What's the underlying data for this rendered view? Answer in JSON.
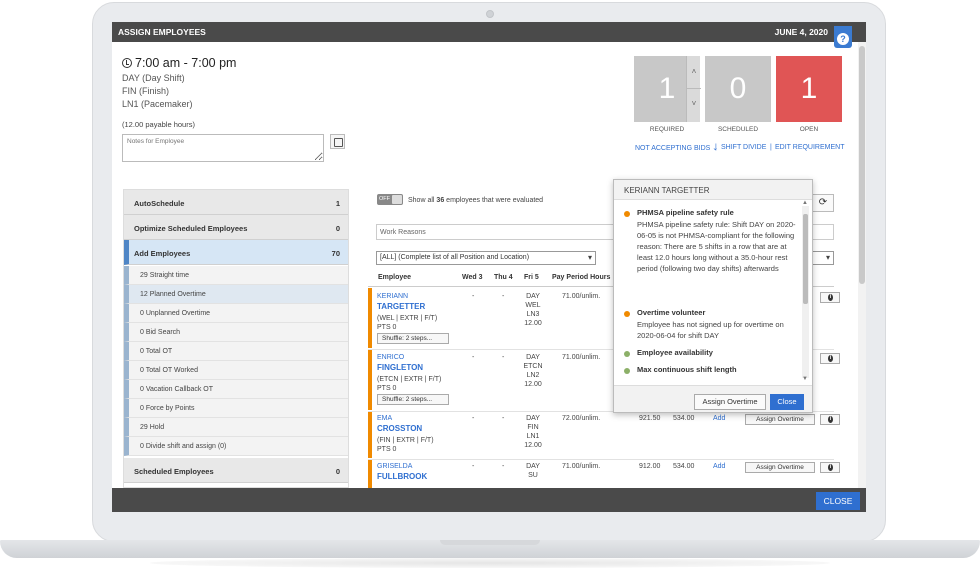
{
  "window": {
    "title": "ASSIGN EMPLOYEES",
    "date": "JUNE 4, 2020",
    "help_glyph": "?",
    "close_label": "CLOSE"
  },
  "shift": {
    "time": "7:00 am - 7:00 pm",
    "lines": [
      "DAY (Day Shift)",
      "FIN (Finish)",
      "LN1 (Pacemaker)"
    ],
    "payable": "(12.00 payable hours)",
    "notes_placeholder": "Notes for Employee"
  },
  "counters": [
    {
      "value": "1",
      "label": "REQUIRED",
      "color": "#c8c8c8"
    },
    {
      "value": "0",
      "label": "SCHEDULED",
      "color": "#c8c8c8"
    },
    {
      "value": "1",
      "label": "OPEN",
      "color": "#e05555"
    }
  ],
  "links": {
    "bids": "NOT ACCEPTING BIDS",
    "bids_caret": "⌄",
    "divide": "SHIFT DIVIDE",
    "edit": "EDIT REQUIREMENT",
    "separator": "|"
  },
  "left_panel": {
    "sections": [
      {
        "label": "AutoSchedule",
        "count": "1"
      },
      {
        "label": "Optimize Scheduled Employees",
        "count": "0"
      },
      {
        "label": "Add Employees",
        "count": "70"
      }
    ],
    "sub_items": [
      "29 Straight time",
      "12 Planned Overtime",
      "0 Unplanned Overtime",
      "0 Bid Search",
      "0 Total OT",
      "0 Total OT Worked",
      "0 Vacation Callback OT",
      "0 Force by Points",
      "29 Hold",
      "0 Divide shift and assign (0)"
    ],
    "footer_section": {
      "label": "Scheduled Employees",
      "count": "0"
    }
  },
  "filter": {
    "toggle": "OFF",
    "show_all_pre": "Show all",
    "show_all_count": "36",
    "show_all_post": "employees that were evaluated",
    "reasons_placeholder": "Work Reasons",
    "position_select": "[ALL] (Complete list of all Position and Location)",
    "select_arrow": "▾",
    "refresh_glyph": "⟳"
  },
  "table": {
    "headers": [
      "Employee",
      "Wed 3",
      "Thu 4",
      "Fri 5",
      "Pay Period Hours"
    ],
    "rows": [
      {
        "first": "KERIANN",
        "last": "TARGETTER",
        "meta": "(WEL | EXTR | F/T)",
        "pts": "PTS 0",
        "shuffle": "Shuffle: 2 steps...",
        "wed": "-",
        "thu": "-",
        "fri": [
          "DAY",
          "WEL",
          "LN3",
          "12.00"
        ],
        "pp": "71.00/unlim."
      },
      {
        "first": "ENRICO",
        "last": "FINGLETON",
        "meta": "(ETCN | EXTR | F/T)",
        "pts": "PTS 0",
        "shuffle": "Shuffle: 2 steps...",
        "wed": "-",
        "thu": "-",
        "fri": [
          "DAY",
          "ETCN",
          "LN2",
          "12.00"
        ],
        "pp": "71.00/unlim."
      },
      {
        "first": "EMA",
        "last": "CROSSTON",
        "meta": "(FIN | EXTR | F/T)",
        "pts": "PTS 0",
        "shuffle": "",
        "wed": "-",
        "thu": "-",
        "fri": [
          "DAY",
          "FIN",
          "LN1",
          "12.00"
        ],
        "pp": "72.00/unlim.",
        "c1": "921.50",
        "c2": "534.00",
        "add": "Add",
        "assign": "Assign Overtime"
      },
      {
        "first": "GRISELDA",
        "last": "FULLBROOK",
        "meta": "",
        "pts": "",
        "shuffle": "",
        "wed": "-",
        "thu": "-",
        "fri": [
          "DAY",
          "SU"
        ],
        "pp": "71.00/unlim.",
        "c1": "912.00",
        "c2": "534.00",
        "add": "Add",
        "assign": "Assign Overtime"
      }
    ]
  },
  "popup": {
    "title": "KERIANN TARGETTER",
    "items": [
      {
        "status": "#f08a00",
        "head": "PHMSA pipeline safety rule",
        "body": "PHMSA pipeline safety rule: Shift DAY on 2020-06-05 is not PHMSA-compliant for the following reason: There are 5 shifts in a row that are at least 12.0 hours long without a 35.0-hour rest period (following two day shifts) afterwards"
      },
      {
        "status": "#f08a00",
        "head": "Overtime volunteer",
        "body": "Employee has not signed up for overtime on 2020-06-04 for shift DAY"
      },
      {
        "status": "#8cb068",
        "head": "Employee availability",
        "body": ""
      },
      {
        "status": "#8cb068",
        "head": "Max continuous shift length",
        "body": ""
      }
    ],
    "assign_label": "Assign Overtime",
    "close_label": "Close",
    "arrow_up": "▲",
    "arrow_down": "▼"
  }
}
